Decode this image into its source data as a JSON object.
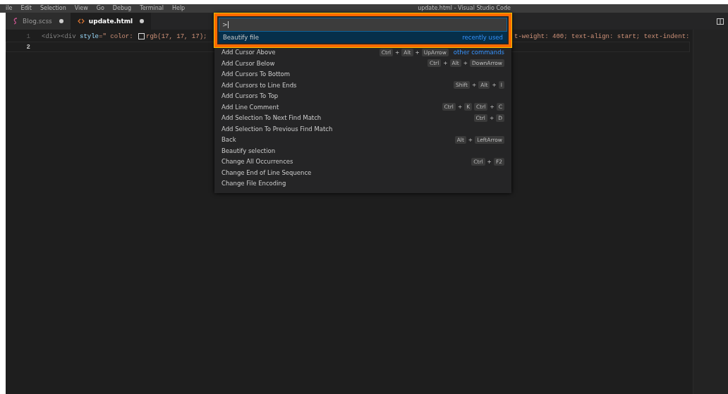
{
  "menu": {
    "items": [
      "ile",
      "Edit",
      "Selection",
      "View",
      "Go",
      "Debug",
      "Terminal",
      "Help"
    ],
    "title": "update.html - Visual Studio Code"
  },
  "tabs": [
    {
      "label": "Blog.scss",
      "kind": "scss",
      "dirty": true,
      "selected": false
    },
    {
      "label": "update.html",
      "kind": "html",
      "dirty": true,
      "selected": true
    }
  ],
  "editor": {
    "lines": [
      {
        "number": "1",
        "current": false,
        "left": [
          {
            "text": "<div><div ",
            "kind": "tag"
          },
          {
            "text": "style",
            "kind": "attr"
          },
          {
            "text": "=\" color: ",
            "kind": "string"
          },
          {
            "kind": "swatch"
          },
          {
            "text": "rgb(17, 17, 17);",
            "kind": "string"
          }
        ],
        "right": [
          {
            "text": "t-weight: 400; text-align: start; text-indent:",
            "kind": "string"
          }
        ]
      },
      {
        "number": "2",
        "current": true
      }
    ]
  },
  "palette": {
    "value": ">",
    "items": [
      {
        "label": "Beautify file",
        "selected": true,
        "note": "recently used"
      },
      {
        "label": "Add Cursor Above",
        "selected": false,
        "keys": [
          [
            "Ctrl",
            "+",
            "Alt",
            "+",
            "UpArrow"
          ]
        ],
        "note": "other commands"
      },
      {
        "label": "Add Cursor Below",
        "selected": false,
        "keys": [
          [
            "Ctrl",
            "+",
            "Alt",
            "+",
            "DownArrow"
          ]
        ]
      },
      {
        "label": "Add Cursors To Bottom",
        "selected": false
      },
      {
        "label": "Add Cursors to Line Ends",
        "selected": false,
        "keys": [
          [
            "Shift",
            "+",
            "Alt",
            "+",
            "I"
          ]
        ]
      },
      {
        "label": "Add Cursors To Top",
        "selected": false
      },
      {
        "label": "Add Line Comment",
        "selected": false,
        "keys": [
          [
            "Ctrl",
            "+",
            "K"
          ],
          [
            "Ctrl",
            "+",
            "C"
          ]
        ]
      },
      {
        "label": "Add Selection To Next Find Match",
        "selected": false,
        "keys": [
          [
            "Ctrl",
            "+",
            "D"
          ]
        ]
      },
      {
        "label": "Add Selection To Previous Find Match",
        "selected": false
      },
      {
        "label": "Back",
        "selected": false,
        "keys": [
          [
            "Alt",
            "+",
            "LeftArrow"
          ]
        ]
      },
      {
        "label": "Beautify selection",
        "selected": false
      },
      {
        "label": "Change All Occurrences",
        "selected": false,
        "keys": [
          [
            "Ctrl",
            "+",
            "F2"
          ]
        ]
      },
      {
        "label": "Change End of Line Sequence",
        "selected": false
      },
      {
        "label": "Change File Encoding",
        "selected": false
      }
    ]
  }
}
